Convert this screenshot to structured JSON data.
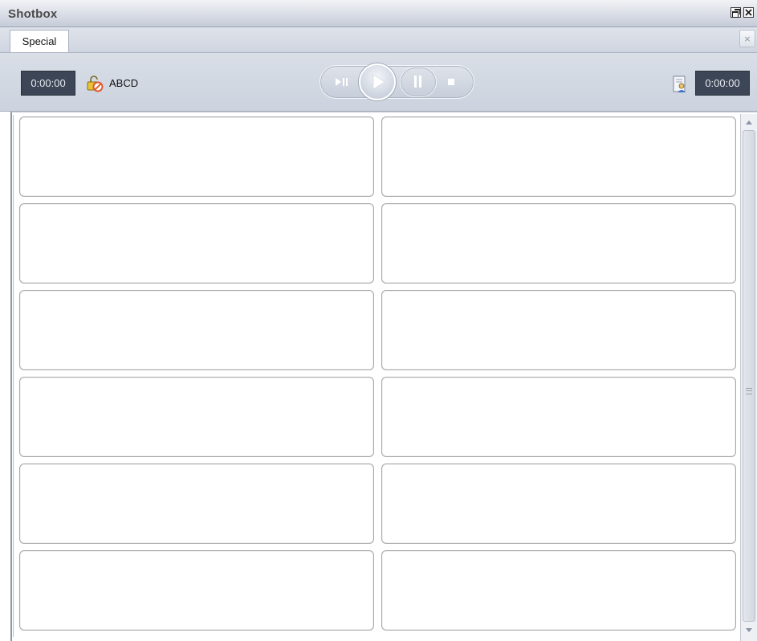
{
  "window": {
    "title": "Shotbox",
    "controls": [
      "restore-icon",
      "close-icon"
    ]
  },
  "tabs": [
    {
      "label": "Special",
      "active": true
    }
  ],
  "tab_close_label": "×",
  "toolbar": {
    "left_time": "0:00:00",
    "right_time": "0:00:00",
    "list_name": "ABCD",
    "transport": [
      "play-pause-icon",
      "play-icon",
      "pause-icon",
      "stop-icon"
    ]
  },
  "grid": {
    "columns": 2,
    "rows": 6,
    "cells": [
      "",
      "",
      "",
      "",
      "",
      "",
      "",
      "",
      "",
      "",
      "",
      ""
    ]
  },
  "colors": {
    "time_box_bg": "#3d4656",
    "toolbar_bg": "#ccd3de",
    "lock_icon": "#e8c33a",
    "no_entry_icon": "#e05a2a"
  }
}
